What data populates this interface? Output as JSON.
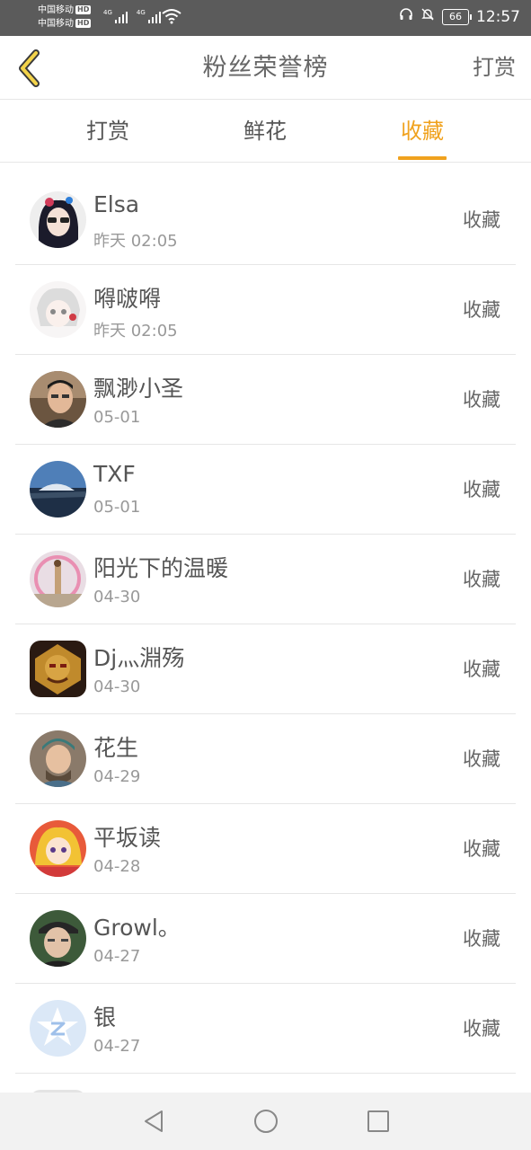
{
  "status_bar": {
    "carrier1": "中国移动",
    "carrier2": "中国移动",
    "hd_badge": "HD",
    "network1": "4G",
    "network2": "4G",
    "battery": "66",
    "time": "12:57",
    "icons": [
      "wifi-icon",
      "headset-icon",
      "bell-off-icon",
      "battery-icon"
    ]
  },
  "header": {
    "back_icon": "chevron-left-icon",
    "title": "粉丝荣誉榜",
    "action": "打赏"
  },
  "tabs": [
    {
      "label": "打赏",
      "active": false
    },
    {
      "label": "鲜花",
      "active": false
    },
    {
      "label": "收藏",
      "active": true
    }
  ],
  "accent_color": "#f0a21e",
  "list": [
    {
      "name": "Elsa",
      "time": "昨天 02:05",
      "action": "收藏"
    },
    {
      "name": "嘚啵嘚",
      "time": "昨天 02:05",
      "action": "收藏"
    },
    {
      "name": "飘渺小圣",
      "time": "05-01",
      "action": "收藏"
    },
    {
      "name": "TXF",
      "time": "05-01",
      "action": "收藏"
    },
    {
      "name": "阳光下的温暖",
      "time": "04-30",
      "action": "收藏"
    },
    {
      "name": "Dj灬淵殇",
      "time": "04-30",
      "action": "收藏"
    },
    {
      "name": "花生",
      "time": "04-29",
      "action": "收藏"
    },
    {
      "name": "平坂读",
      "time": "04-28",
      "action": "收藏"
    },
    {
      "name": "Growl。",
      "time": "04-27",
      "action": "收藏"
    },
    {
      "name": "银",
      "time": "04-27",
      "action": "收藏"
    }
  ],
  "navbar": {
    "icons": [
      "back-triangle-icon",
      "home-circle-icon",
      "recents-square-icon"
    ]
  }
}
